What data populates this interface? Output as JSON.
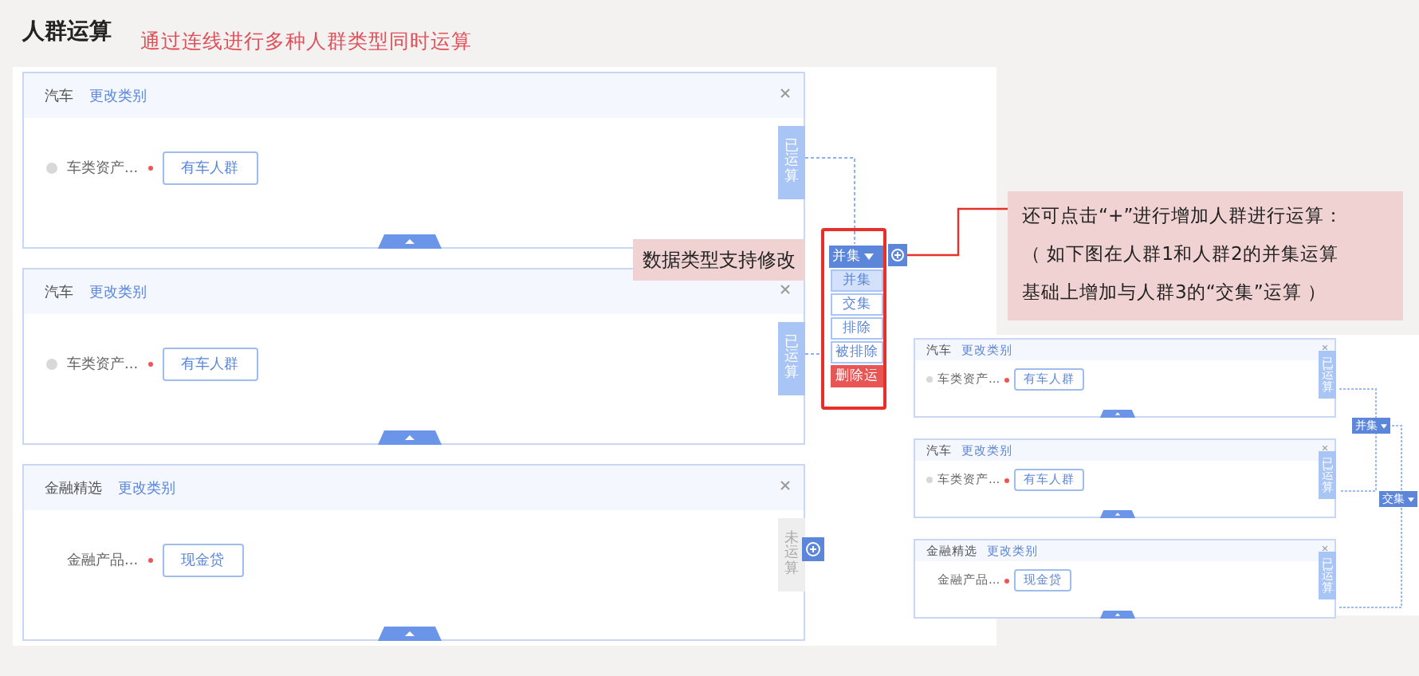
{
  "title": "人群运算",
  "subtitle": "通过连线进行多种人群类型同时运算",
  "cards": [
    {
      "category": "汽车",
      "change_link": "更改类别",
      "has_radio": true,
      "field_label": "车类资产...",
      "value": "有车人群",
      "status": "已运算",
      "computed": true
    },
    {
      "category": "汽车",
      "change_link": "更改类别",
      "has_radio": true,
      "field_label": "车类资产...",
      "value": "有车人群",
      "status": "已运算",
      "computed": true
    },
    {
      "category": "金融精选",
      "change_link": "更改类别",
      "has_radio": false,
      "field_label": "金融产品...",
      "value": "现金贷",
      "status": "未运算",
      "computed": false
    }
  ],
  "operation": {
    "current": "并集",
    "options": [
      {
        "label": "并集",
        "kind": "option",
        "selected": true
      },
      {
        "label": "交集",
        "kind": "option",
        "selected": false
      },
      {
        "label": "排除",
        "kind": "option",
        "selected": false
      },
      {
        "label": "被排除",
        "kind": "option",
        "selected": false
      },
      {
        "label": "删除运",
        "kind": "delete",
        "selected": false
      }
    ]
  },
  "callouts": [
    {
      "lines": [
        "数据类型支持修改"
      ]
    },
    {
      "lines": [
        "还可点击“+”进行增加人群进行运算：",
        "（ 如下图在人群1和人群2的并集运算",
        "基础上增加与人群3的“交集”运算 ）"
      ]
    }
  ],
  "example": {
    "cards": [
      {
        "category": "汽车",
        "change_link": "更改类别",
        "has_radio": true,
        "field_label": "车类资产...",
        "value": "有车人群",
        "status": "已运算",
        "computed": true
      },
      {
        "category": "汽车",
        "change_link": "更改类别",
        "has_radio": true,
        "field_label": "车类资产...",
        "value": "有车人群",
        "status": "已运算",
        "computed": true
      },
      {
        "category": "金融精选",
        "change_link": "更改类别",
        "has_radio": false,
        "field_label": "金融产品...",
        "value": "现金贷",
        "status": "已运算",
        "computed": true
      }
    ],
    "operations": [
      "并集",
      "交集"
    ]
  }
}
